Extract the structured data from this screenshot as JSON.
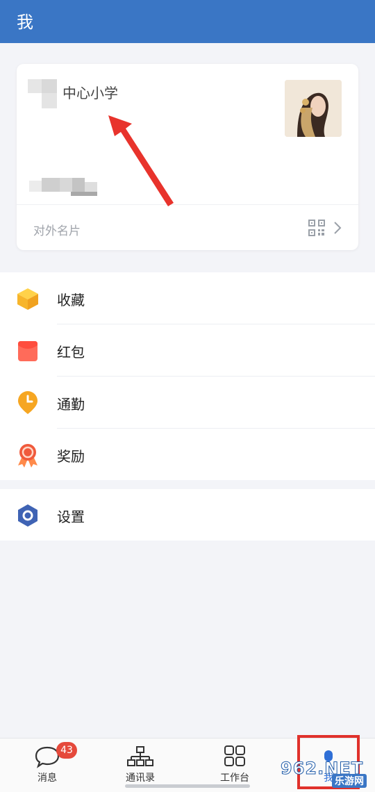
{
  "header": {
    "title": "我"
  },
  "profile_card": {
    "org_name": "中心小学",
    "external_card_label": "对外名片"
  },
  "menu": {
    "items": [
      {
        "label": "收藏",
        "icon": "favorite-cube-icon"
      },
      {
        "label": "红包",
        "icon": "red-packet-icon"
      },
      {
        "label": "通勤",
        "icon": "commute-clock-icon"
      },
      {
        "label": "奖励",
        "icon": "reward-medal-icon"
      }
    ],
    "settings": {
      "label": "设置",
      "icon": "settings-hex-icon"
    }
  },
  "tabbar": {
    "tabs": [
      {
        "label": "消息",
        "icon": "chat-bubble-icon",
        "badge": "43"
      },
      {
        "label": "通讯录",
        "icon": "org-chart-icon"
      },
      {
        "label": "工作台",
        "icon": "grid-icon"
      },
      {
        "label": "我",
        "icon": "person-icon",
        "active": true
      }
    ]
  },
  "watermark": {
    "logo": "962.NET",
    "sub": "乐游网"
  },
  "colors": {
    "header": "#3a76c5",
    "badge": "#e5493b",
    "highlight": "#e0312b",
    "arrow": "#e8332c"
  }
}
